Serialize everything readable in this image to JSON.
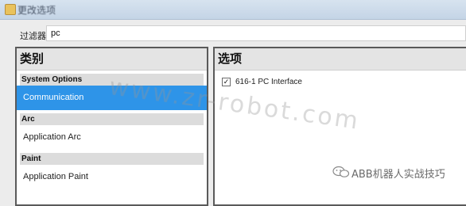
{
  "window": {
    "title": "更改选项"
  },
  "filter": {
    "label": "过滤器",
    "value": "pc"
  },
  "categories": {
    "header": "类别",
    "groups": [
      {
        "name": "System Options",
        "items": [
          {
            "label": "Communication",
            "selected": true
          }
        ]
      },
      {
        "name": "Arc",
        "items": [
          {
            "label": "Application Arc",
            "selected": false
          }
        ]
      },
      {
        "name": "Paint",
        "items": [
          {
            "label": "Application Paint",
            "selected": false
          }
        ]
      }
    ]
  },
  "options": {
    "header": "选项",
    "items": [
      {
        "label": "616-1 PC Interface",
        "checked": true,
        "check_glyph": "✓"
      }
    ]
  },
  "watermark": {
    "text": "www.zr-robot.com"
  },
  "branding": {
    "text": "ABB机器人实战技巧",
    "icon": "wechat-icon"
  },
  "colors": {
    "selection": "#2e94e8",
    "border": "#5a5a5a",
    "group_bg": "#dcdcdc"
  }
}
